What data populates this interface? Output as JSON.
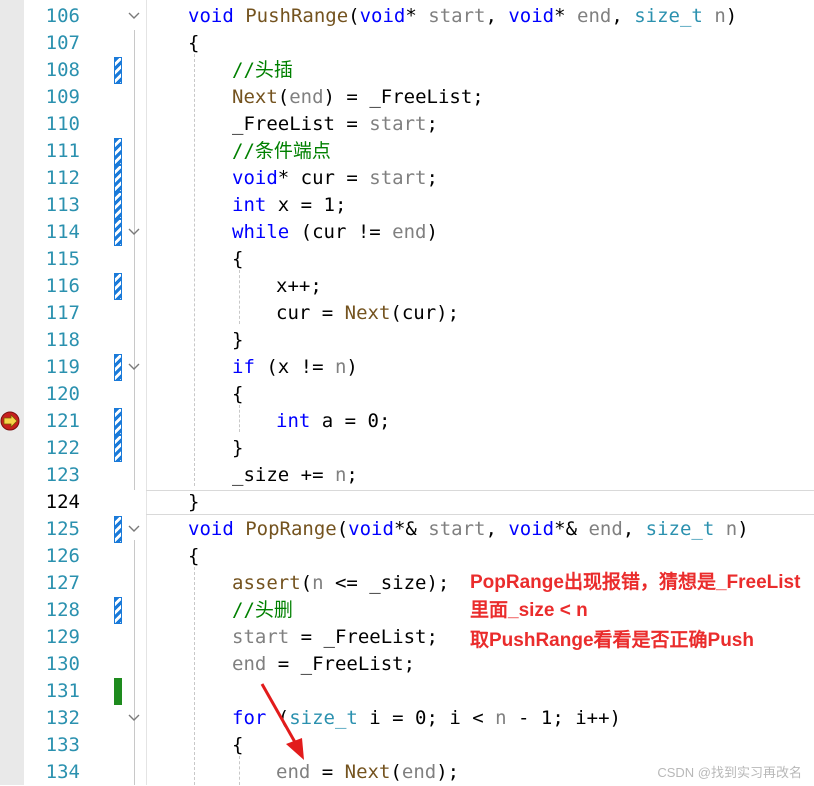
{
  "editor": {
    "lines": [
      {
        "num": "106",
        "tokens": [
          [
            "kw",
            "void"
          ],
          [
            "",
            ""
          ],
          [
            "fn",
            " PushRange"
          ],
          [
            "",
            "("
          ],
          [
            "kw",
            "void"
          ],
          [
            "",
            "*"
          ],
          [
            "pa",
            " start"
          ],
          [
            "",
            ", "
          ],
          [
            "kw",
            "void"
          ],
          [
            "",
            "*"
          ],
          [
            "pa",
            " end"
          ],
          [
            "",
            ", "
          ],
          [
            "ty",
            "size_t"
          ],
          [
            "pa",
            " n"
          ],
          [
            "",
            ")"
          ]
        ]
      },
      {
        "num": "107",
        "tokens": [
          [
            "",
            "{"
          ]
        ]
      },
      {
        "num": "108",
        "tokens": [
          [
            "cm",
            "//"
          ],
          [
            "cm-zh",
            "头插"
          ]
        ]
      },
      {
        "num": "109",
        "tokens": [
          [
            "fn",
            "Next"
          ],
          [
            "",
            "("
          ],
          [
            "pa",
            "end"
          ],
          [
            "",
            ") = "
          ],
          [
            "",
            "_FreeList"
          ],
          [
            "",
            ";"
          ]
        ]
      },
      {
        "num": "110",
        "tokens": [
          [
            "",
            "_FreeList = "
          ],
          [
            "pa",
            "start"
          ],
          [
            "",
            ";"
          ]
        ]
      },
      {
        "num": "111",
        "tokens": [
          [
            "cm",
            "//"
          ],
          [
            "cm-zh",
            "条件端点"
          ]
        ]
      },
      {
        "num": "112",
        "tokens": [
          [
            "kw",
            "void"
          ],
          [
            "",
            "* "
          ],
          [
            "",
            "cur = "
          ],
          [
            "pa",
            "start"
          ],
          [
            "",
            ";"
          ]
        ]
      },
      {
        "num": "113",
        "tokens": [
          [
            "kw",
            "int"
          ],
          [
            "",
            ""
          ],
          [
            "",
            ""
          ],
          [
            "",
            ""
          ],
          [
            "",
            ""
          ],
          [
            "",
            ""
          ],
          [
            "",
            ""
          ],
          [
            "",
            ""
          ],
          [
            "",
            ""
          ],
          [
            "",
            ""
          ],
          [
            "",
            ""
          ],
          [
            "",
            ""
          ],
          [
            "",
            ""
          ],
          [
            "",
            ""
          ],
          [
            "",
            ""
          ]
        ]
      },
      {
        "num": "114",
        "tokens": [
          [
            "kw",
            "while"
          ],
          [
            "",
            " (cur != "
          ],
          [
            "pa",
            "end"
          ],
          [
            "",
            ")"
          ]
        ]
      },
      {
        "num": "115",
        "tokens": [
          [
            "",
            "{"
          ]
        ]
      },
      {
        "num": "116",
        "tokens": [
          [
            "",
            "x++;"
          ]
        ]
      },
      {
        "num": "117",
        "tokens": [
          [
            "",
            "cur = "
          ],
          [
            "fn",
            "Next"
          ],
          [
            "",
            "(cur);"
          ]
        ]
      },
      {
        "num": "118",
        "tokens": [
          [
            "",
            "}"
          ]
        ]
      },
      {
        "num": "119",
        "tokens": [
          [
            "kw",
            "if"
          ],
          [
            "",
            " (x != "
          ],
          [
            "pa",
            "n"
          ],
          [
            "",
            ")"
          ]
        ]
      },
      {
        "num": "120",
        "tokens": [
          [
            "",
            "{"
          ]
        ]
      },
      {
        "num": "121",
        "tokens": [
          [
            "kw",
            "int"
          ],
          [
            "",
            " a = 0;"
          ]
        ]
      },
      {
        "num": "122",
        "tokens": [
          [
            "",
            "}"
          ]
        ]
      },
      {
        "num": "123",
        "tokens": [
          [
            "",
            "_size += "
          ],
          [
            "pa",
            "n"
          ],
          [
            "",
            ";"
          ]
        ]
      },
      {
        "num": "124",
        "tokens": [
          [
            "",
            "}"
          ]
        ]
      },
      {
        "num": "125",
        "tokens": [
          [
            "kw",
            "void"
          ],
          [
            "fn",
            " PopRange"
          ],
          [
            "",
            "("
          ],
          [
            "kw",
            "void"
          ],
          [
            "",
            "*& "
          ],
          [
            "pa",
            "start"
          ],
          [
            "",
            ", "
          ],
          [
            "kw",
            "void"
          ],
          [
            "",
            "*& "
          ],
          [
            "pa",
            "end"
          ],
          [
            "",
            ", "
          ],
          [
            "ty",
            "size_t"
          ],
          [
            "pa",
            " n"
          ],
          [
            "",
            ")"
          ]
        ]
      },
      {
        "num": "126",
        "tokens": [
          [
            "",
            "{"
          ]
        ]
      },
      {
        "num": "127",
        "tokens": [
          [
            "fn",
            "assert"
          ],
          [
            "",
            "("
          ],
          [
            "pa",
            "n"
          ],
          [
            "",
            " <= _size);"
          ]
        ]
      },
      {
        "num": "128",
        "tokens": [
          [
            "cm",
            "//"
          ],
          [
            "cm-zh",
            "头删"
          ]
        ]
      },
      {
        "num": "129",
        "tokens": [
          [
            "pa",
            "start"
          ],
          [
            "",
            " = _FreeList;"
          ]
        ]
      },
      {
        "num": "130",
        "tokens": [
          [
            "pa",
            "end"
          ],
          [
            "",
            " = _FreeList;"
          ]
        ]
      },
      {
        "num": "131",
        "tokens": []
      },
      {
        "num": "132",
        "tokens": [
          [
            "kw",
            "for"
          ],
          [
            "",
            " ("
          ],
          [
            "ty",
            "size_t"
          ],
          [
            "",
            " i = 0; i < "
          ],
          [
            "pa",
            "n"
          ],
          [
            "",
            " - 1; i++)"
          ]
        ]
      },
      {
        "num": "133",
        "tokens": [
          [
            "",
            "{"
          ]
        ]
      },
      {
        "num": "134",
        "tokens": [
          [
            "pa",
            "end"
          ],
          [
            "",
            " = "
          ],
          [
            "fn",
            "Next"
          ],
          [
            "",
            "("
          ],
          [
            "pa",
            "end"
          ],
          [
            "",
            ");"
          ]
        ]
      }
    ]
  },
  "annotation": {
    "line1": "PopRange出现报错，猜想是_FreeList",
    "line2": "里面_size < n",
    "line3": "取PushRange看看是否正确Push"
  },
  "watermark": "CSDN @找到实习再改名",
  "colors": {
    "keyword": "#0000ff",
    "type": "#2b91af",
    "param": "#808080",
    "function": "#74531f",
    "comment": "#008000",
    "annotation": "#ea2c2c",
    "line_number": "#2b91af"
  }
}
